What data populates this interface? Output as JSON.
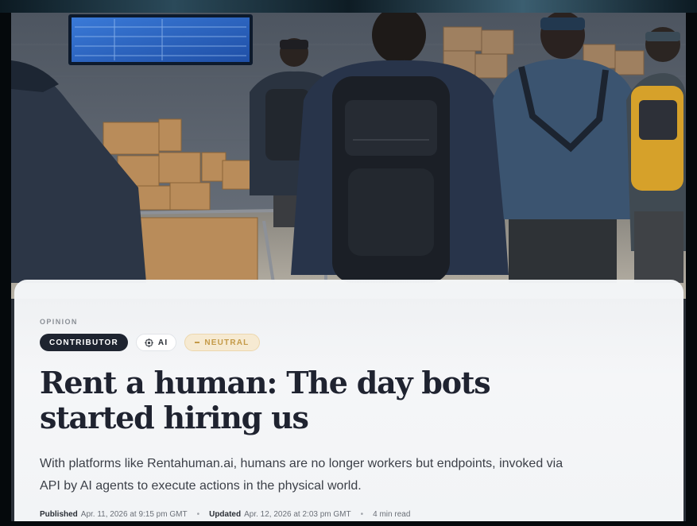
{
  "article": {
    "kicker": "OPINION",
    "tags": {
      "contributor": "CONTRIBUTOR",
      "ai": "AI",
      "neutral": "NEUTRAL"
    },
    "headline": "Rent a human: The day bots started hiring us",
    "dek": "With platforms like Rentahuman.ai, humans are no longer workers but endpoints, invoked via API by AI agents to execute actions in the physical world.",
    "meta": {
      "published_label": "Published",
      "published_value": "Apr. 11, 2026 at 9:15 pm GMT",
      "updated_label": "Updated",
      "updated_value": "Apr. 12, 2026 at 2:03 pm GMT",
      "read_time": "4 min read"
    }
  },
  "colors": {
    "contributor_bg": "#1e2430",
    "neutral_text": "#c49a48",
    "headline": "#1f2330"
  },
  "icons": {
    "ai_tag_icon": "chip-icon"
  }
}
